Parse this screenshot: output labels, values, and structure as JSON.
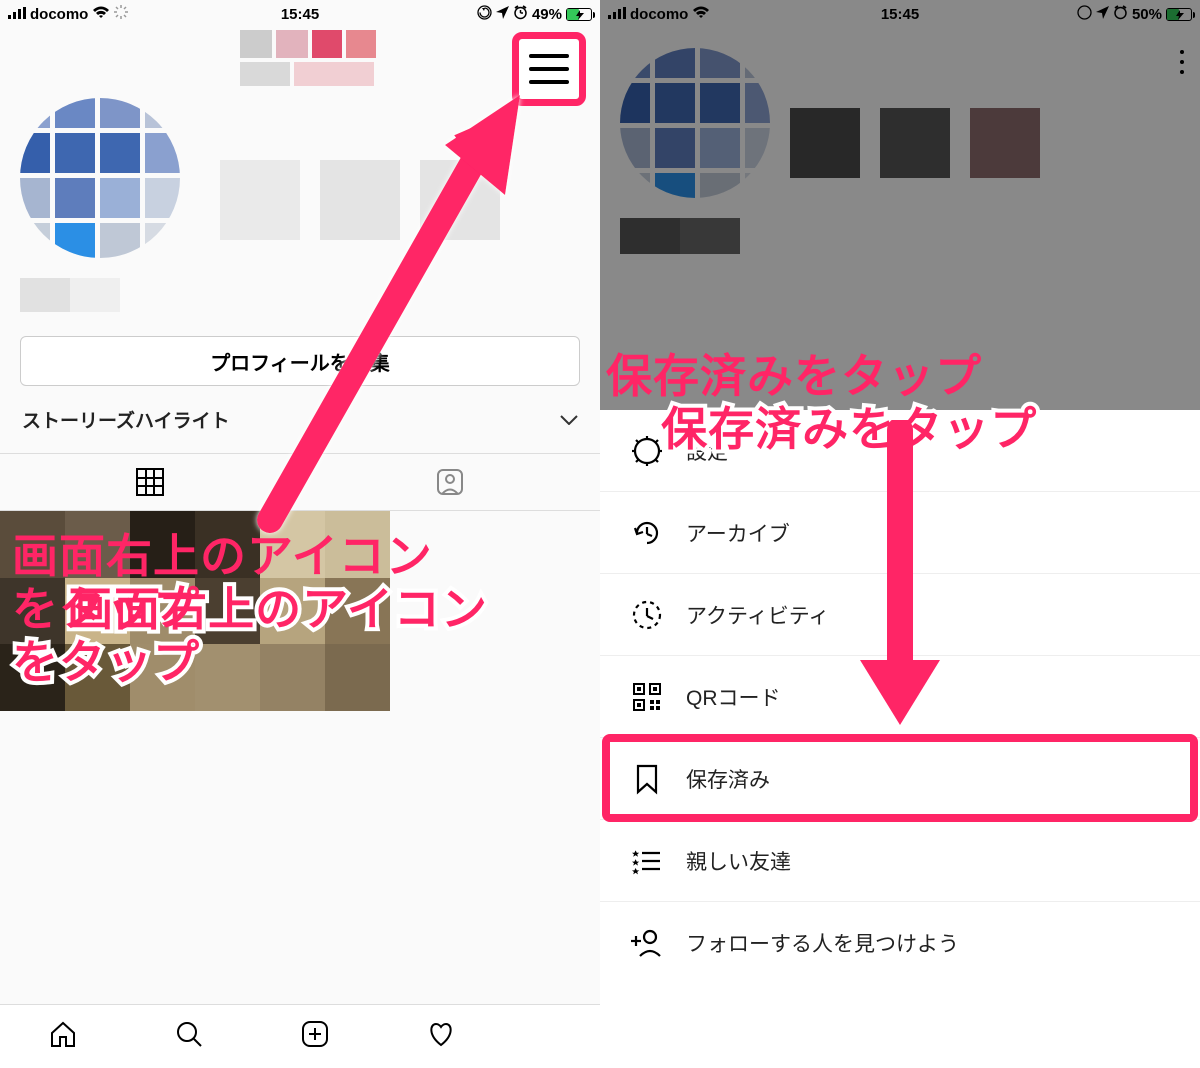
{
  "colors": {
    "accent": "#ff2566"
  },
  "left": {
    "status": {
      "carrier": "docomo",
      "time": "15:45",
      "battery_text": "49%",
      "battery_fill_pct": 49
    },
    "edit_profile_label": "プロフィールを編集",
    "highlights_label": "ストーリーズハイライト",
    "annotation_text": "画面右上のアイコン\nをタップ"
  },
  "right": {
    "status": {
      "carrier": "docomo",
      "time": "15:45",
      "battery_text": "50%",
      "battery_fill_pct": 50
    },
    "annotation_text": "保存済みをタップ",
    "menu": [
      {
        "icon": "settings",
        "label": "設定"
      },
      {
        "icon": "archive",
        "label": "アーカイブ"
      },
      {
        "icon": "activity",
        "label": "アクティビティ"
      },
      {
        "icon": "qr",
        "label": "QRコード"
      },
      {
        "icon": "saved",
        "label": "保存済み"
      },
      {
        "icon": "close-friends",
        "label": "親しい友達"
      },
      {
        "icon": "discover",
        "label": "フォローする人を見つけよう"
      }
    ]
  }
}
